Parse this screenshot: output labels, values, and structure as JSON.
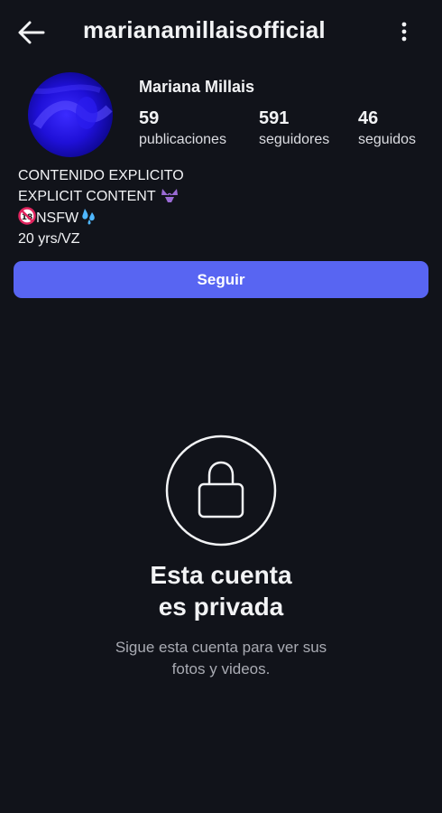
{
  "header": {
    "username": "marianamillaisofficial",
    "back_icon": "arrow-left-icon",
    "more_icon": "more-vertical-icon"
  },
  "profile": {
    "display_name": "Mariana Millais",
    "stats": [
      {
        "value": "59",
        "label": "publicaciones"
      },
      {
        "value": "591",
        "label": "seguidores"
      },
      {
        "value": "46",
        "label": "seguidos"
      }
    ],
    "bio": {
      "line1": "CONTENIDO EXPLICITO",
      "line2": "EXPLICIT CONTENT",
      "line3": "NSFW",
      "line4": "20 yrs/VZ"
    }
  },
  "follow_button": {
    "label": "Seguir"
  },
  "private": {
    "icon": "lock-icon",
    "title_line1": "Esta cuenta",
    "title_line2": "es privada",
    "sub_line1": "Sigue esta cuenta para ver sus",
    "sub_line2": "fotos y videos."
  },
  "colors": {
    "background": "#11131a",
    "accent": "#5865f2",
    "text": "#f2f3f5",
    "muted": "#a9abb3"
  }
}
